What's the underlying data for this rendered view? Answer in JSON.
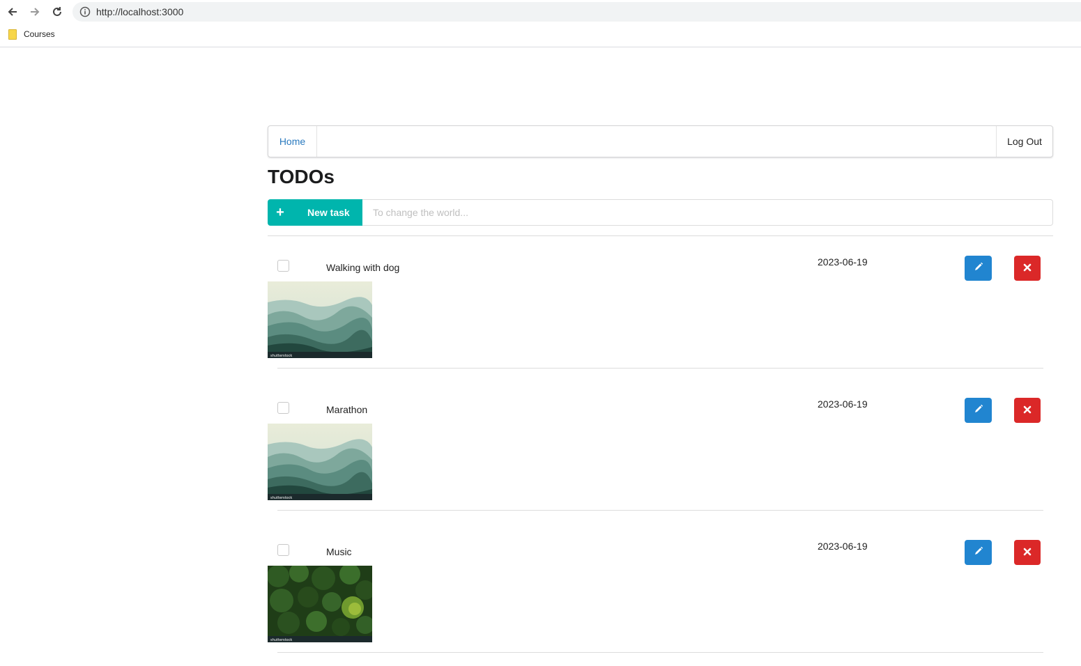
{
  "browser": {
    "url": "http://localhost:3000",
    "bookmark": "Courses"
  },
  "nav": {
    "home": "Home",
    "logout": "Log Out"
  },
  "page": {
    "title": "TODOs"
  },
  "new_task": {
    "button_label": "New task",
    "placeholder": "To change the world..."
  },
  "todos": [
    {
      "label": "Walking with dog",
      "date": "2023-06-19",
      "image": "misty-mountains",
      "watermark": "shutterstock"
    },
    {
      "label": "Marathon",
      "date": "2023-06-19",
      "image": "misty-mountains",
      "watermark": "shutterstock"
    },
    {
      "label": "Music",
      "date": "2023-06-19",
      "image": "forest-canopy",
      "watermark": "shutterstock"
    }
  ],
  "colors": {
    "accent_teal": "#00b5ad",
    "edit_blue": "#2185d0",
    "delete_red": "#db2828",
    "link_blue": "#2a7abf"
  }
}
